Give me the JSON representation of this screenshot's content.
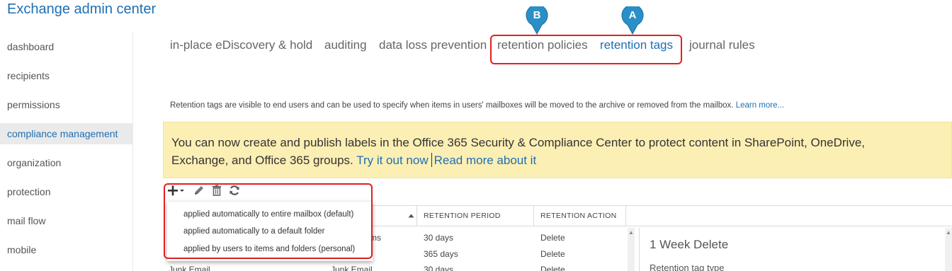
{
  "app": {
    "title": "Exchange admin center"
  },
  "sidebar": {
    "items": [
      {
        "label": "dashboard"
      },
      {
        "label": "recipients"
      },
      {
        "label": "permissions"
      },
      {
        "label": "compliance management",
        "active": true
      },
      {
        "label": "organization"
      },
      {
        "label": "protection"
      },
      {
        "label": "mail flow"
      },
      {
        "label": "mobile"
      }
    ]
  },
  "tabs": [
    {
      "label": "in-place eDiscovery & hold"
    },
    {
      "label": "auditing"
    },
    {
      "label": "data loss prevention"
    },
    {
      "label": "retention policies"
    },
    {
      "label": "retention tags",
      "active": true
    },
    {
      "label": "journal rules"
    }
  ],
  "markers": {
    "a": "A",
    "b": "B"
  },
  "description": {
    "text": "Retention tags are visible to end users and can be used to specify when items in users' mailboxes will be moved to the archive or removed from the mailbox.",
    "link": "Learn more..."
  },
  "banner": {
    "text_line1": "You can now create and publish labels in the Office 365 Security & Compliance Center to protect content in SharePoint, OneDrive,",
    "text_line2": "Exchange, and Office 365 groups.",
    "link1": "Try it out now",
    "link2": "Read more about it"
  },
  "toolbar": {
    "icons": [
      "add-icon",
      "edit-icon",
      "delete-icon",
      "refresh-icon"
    ]
  },
  "table": {
    "columns": [
      "RETENTION PERIOD",
      "RETENTION ACTION"
    ],
    "rows": [
      {
        "name_fragment": "ms",
        "period": "30 days",
        "action": "Delete"
      },
      {
        "name_fragment": "",
        "period": "365 days",
        "action": "Delete"
      },
      {
        "name": "Junk Email",
        "type": "Junk Email",
        "period": "30 days",
        "action": "Delete"
      }
    ]
  },
  "add_menu": {
    "items": [
      "applied automatically to entire mailbox (default)",
      "applied automatically to a default folder",
      "applied by users to items and folders (personal)"
    ]
  },
  "details": {
    "title": "1 Week Delete",
    "field_label": "Retention tag type"
  },
  "colors": {
    "accent": "#1f6fb2",
    "banner": "#fcefb4",
    "callout": "#e02020",
    "marker": "#2a8fc7"
  }
}
